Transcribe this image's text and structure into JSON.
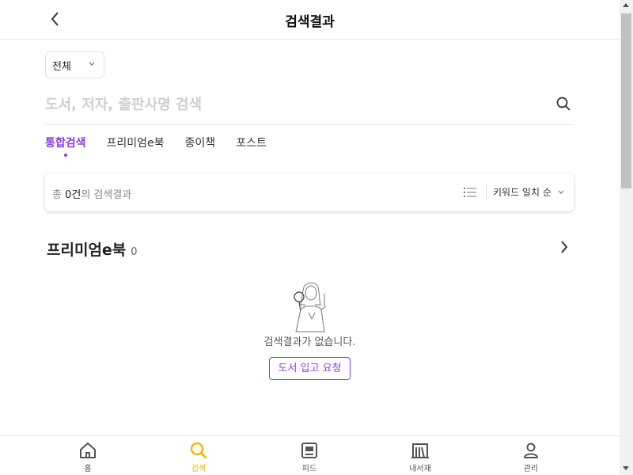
{
  "header": {
    "title": "검색결과",
    "back_icon": "chevron-left-icon"
  },
  "search": {
    "category_selected": "전체",
    "placeholder": "도서, 저자, 출판사명 검색",
    "value": "",
    "search_icon": "search-icon"
  },
  "tabs": [
    {
      "label": "통합검색",
      "active": true
    },
    {
      "label": "프리미엄e북",
      "active": false
    },
    {
      "label": "종이책",
      "active": false
    },
    {
      "label": "포스트",
      "active": false
    }
  ],
  "result_bar": {
    "prefix": "총 ",
    "count": "0건",
    "suffix": "의 검색결과",
    "view_icon": "list-icon",
    "sort_label": "키워드 일치 순"
  },
  "section": {
    "title": "프리미엄e북",
    "count": "0"
  },
  "empty_state": {
    "message": "검색결과가 없습니다.",
    "request_button": "도서 입고 요청"
  },
  "bottom_nav": [
    {
      "label": "홈",
      "icon": "home-icon",
      "active": false
    },
    {
      "label": "검색",
      "icon": "search-icon",
      "active": true
    },
    {
      "label": "피드",
      "icon": "feed-icon",
      "active": false
    },
    {
      "label": "내서재",
      "icon": "library-icon",
      "active": false
    },
    {
      "label": "관리",
      "icon": "profile-icon",
      "active": false
    }
  ],
  "colors": {
    "accent_purple": "#8a3ddc",
    "active_nav_yellow": "#f3b400"
  }
}
